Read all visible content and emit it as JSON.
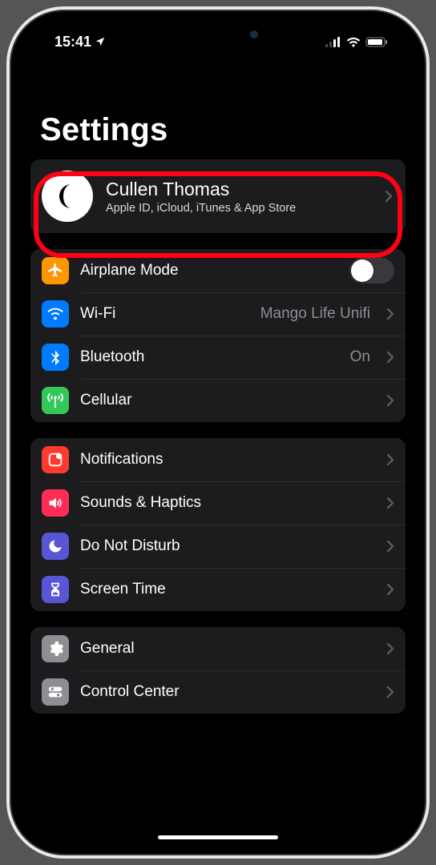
{
  "status": {
    "time": "15:41"
  },
  "page": {
    "title": "Settings"
  },
  "apple_id": {
    "name": "Cullen Thomas",
    "subtitle": "Apple ID, iCloud, iTunes & App Store"
  },
  "groups": [
    {
      "rows": [
        {
          "icon": "airplane",
          "icon_bg": "#ff9500",
          "label": "Airplane Mode",
          "control": "switch",
          "switch_on": false
        },
        {
          "icon": "wifi",
          "icon_bg": "#007aff",
          "label": "Wi-Fi",
          "value": "Mango Life Unifi",
          "chevron": true
        },
        {
          "icon": "bluetooth",
          "icon_bg": "#007aff",
          "label": "Bluetooth",
          "value": "On",
          "chevron": true
        },
        {
          "icon": "cellular",
          "icon_bg": "#34c759",
          "label": "Cellular",
          "chevron": true
        }
      ]
    },
    {
      "rows": [
        {
          "icon": "notifications",
          "icon_bg": "#ff3b30",
          "label": "Notifications",
          "chevron": true
        },
        {
          "icon": "sounds",
          "icon_bg": "#ff2d55",
          "label": "Sounds & Haptics",
          "chevron": true
        },
        {
          "icon": "dnd",
          "icon_bg": "#5856d6",
          "label": "Do Not Disturb",
          "chevron": true
        },
        {
          "icon": "screentime",
          "icon_bg": "#5856d6",
          "label": "Screen Time",
          "chevron": true
        }
      ]
    },
    {
      "rows": [
        {
          "icon": "general",
          "icon_bg": "#8e8e93",
          "label": "General",
          "chevron": true
        },
        {
          "icon": "controlcenter",
          "icon_bg": "#8e8e93",
          "label": "Control Center",
          "chevron": true
        }
      ]
    }
  ]
}
